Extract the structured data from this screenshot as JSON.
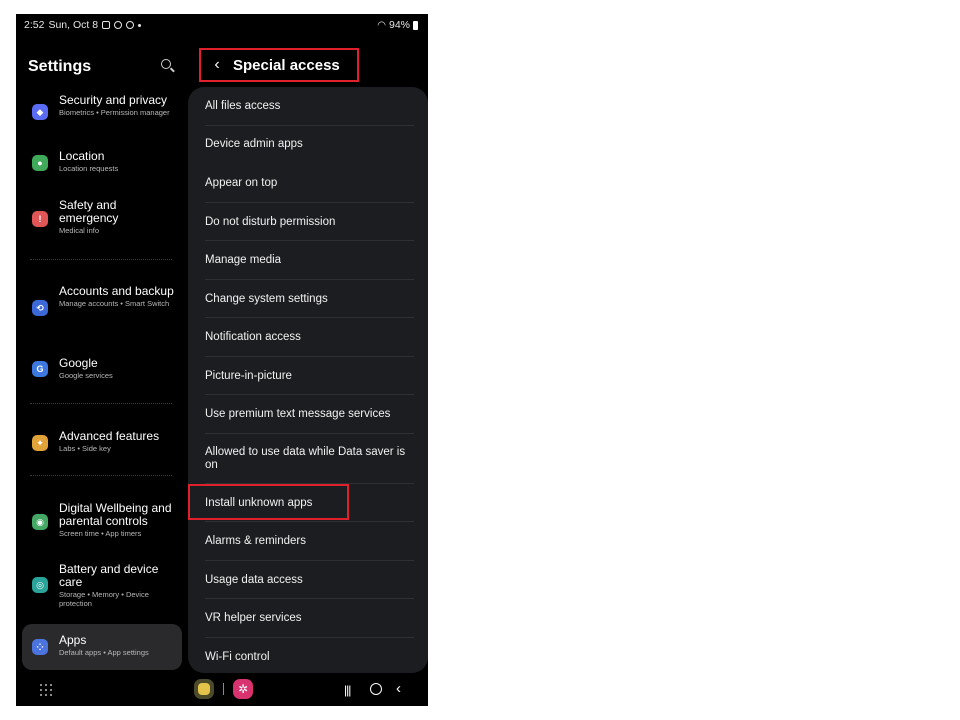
{
  "status_bar": {
    "time": "2:52",
    "date": "Sun, Oct 8",
    "battery": "94%"
  },
  "settings": {
    "title": "Settings",
    "items": [
      {
        "title": "Security and privacy",
        "subtitle": "Biometrics  •  Permission manager",
        "icon": "shield-icon",
        "color": "#5a6cf5"
      },
      {
        "title": "Location",
        "subtitle": "Location requests",
        "icon": "location-pin-icon",
        "color": "#3faa5a"
      },
      {
        "title": "Safety and emergency",
        "subtitle": "Medical info",
        "icon": "emergency-icon",
        "color": "#e05555"
      },
      {
        "title": "Accounts and backup",
        "subtitle": "Manage accounts  •  Smart Switch",
        "icon": "sync-icon",
        "color": "#3d68d8"
      },
      {
        "title": "Google",
        "subtitle": "Google services",
        "icon": "google-icon",
        "color": "#3d78e0"
      },
      {
        "title": "Advanced features",
        "subtitle": "Labs  •  Side key",
        "icon": "advanced-features-icon",
        "color": "#e1a23a"
      },
      {
        "title": "Digital Wellbeing and parental controls",
        "subtitle": "Screen time  •  App timers",
        "icon": "wellbeing-icon",
        "color": "#45a865"
      },
      {
        "title": "Battery and device care",
        "subtitle": "Storage  •  Memory  •  Device protection",
        "icon": "device-care-icon",
        "color": "#2aa39a"
      },
      {
        "title": "Apps",
        "subtitle": "Default apps  •  App settings",
        "icon": "apps-icon",
        "color": "#4c74de"
      }
    ]
  },
  "special_access": {
    "title": "Special access",
    "items": [
      "All files access",
      "Device admin apps",
      "Appear on top",
      "Do not disturb permission",
      "Manage media",
      "Change system settings",
      "Notification access",
      "Picture-in-picture",
      "Use premium text message services",
      "Allowed to use data while Data saver is on",
      "Install unknown apps",
      "Alarms & reminders",
      "Usage data access",
      "VR helper services",
      "Wi-Fi control"
    ]
  },
  "colors": {
    "highlight": "#e0202a",
    "card_bg": "#1c1d20",
    "active_item_bg": "#2a2a2d"
  }
}
